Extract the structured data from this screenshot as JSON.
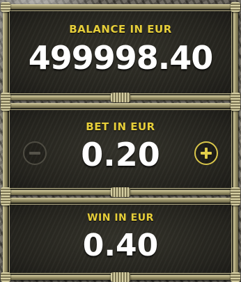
{
  "balance": {
    "label": "BALANCE IN EUR",
    "value": "499998.40"
  },
  "bet": {
    "label": "BET IN EUR",
    "value": "0.20",
    "decrease_icon": "minus-icon",
    "increase_icon": "plus-icon"
  },
  "win": {
    "label": "WIN IN EUR",
    "value": "0.40"
  },
  "colors": {
    "label": "#e7cf3a",
    "value": "#ffffff",
    "panel": "#26251f",
    "frame": "#8f8a66",
    "increase_accent": "#d9c64a",
    "decrease_disabled": "#4e4c42"
  }
}
